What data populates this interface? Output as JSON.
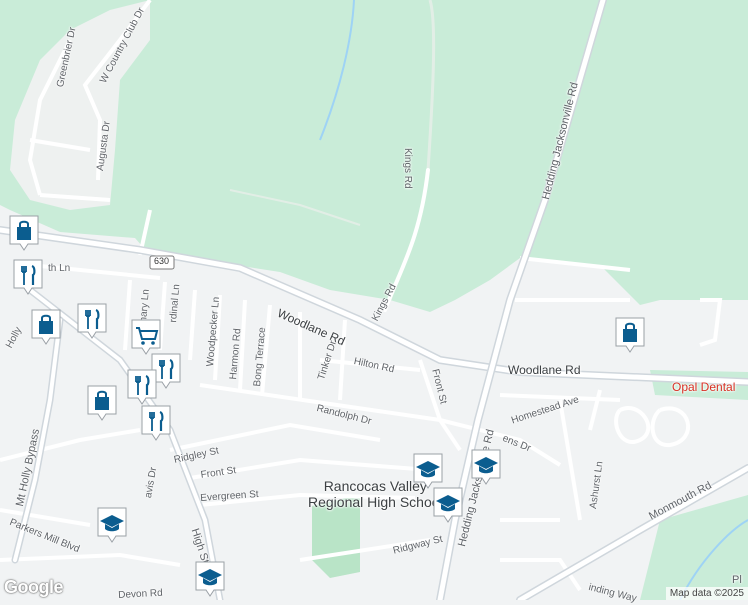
{
  "map": {
    "colors": {
      "forest": "#c9ecd8",
      "background": "#f1f3f4",
      "road_minor": "#ffffff",
      "road_major": "#cfd6dc",
      "water": "#9ed3f5",
      "school_ground": "#b9e4c7",
      "marker_fill": "#0b5d8f",
      "dental_text": "#d93025"
    },
    "roads": {
      "woodlane_1": "Woodlane Rd",
      "woodlane_2": "Woodlane Rd",
      "kings_1": "Kings Rd",
      "kings_2": "Kings Rd",
      "hedding": "Hedding Jacksonville Rd",
      "hedding_low": "Hedding Jacksonville Rd",
      "route_shield": "630",
      "greenbrier": "Greenbrier Dr",
      "w_country_club": "W Country Club Dr",
      "augusta": "Augusta Dr",
      "th_ln": "th Ln",
      "nary_ln": "nary Ln",
      "cardinal_ln": "rdinal Ln",
      "woodpecker": "Woodpecker Ln",
      "harmon": "Harmon Rd",
      "bong": "Bong Terrace",
      "tinker": "Tinker Dr",
      "hilton": "Hilton Rd",
      "front_st_v": "Front St",
      "homestead": "Homestead Ave",
      "randolph": "Randolph Dr",
      "ridgley": "Ridgley St",
      "front_st_h": "Front St",
      "evergreen": "Evergreen St",
      "mt_holly_bypass": "Mt Holly Bypass",
      "holly": "Holly",
      "parkers_mill": "Parkers Mill Blvd",
      "high_st": "High St",
      "avis": "avis Dr",
      "ridgway": "Ridgway St",
      "stevens": "ens Dr",
      "ashurst": "Ashurst Ln",
      "monmouth": "Monmouth Rd",
      "devon": "Devon Rd",
      "winding_way": "inding Way"
    },
    "poi": {
      "school_line1": "Rancocas Valley",
      "school_line2": "Regional High School",
      "dental": "Opal Dental",
      "partial_pl": "Pl"
    },
    "markers": [
      {
        "icon": "shopping-bag-icon"
      },
      {
        "icon": "shopping-bag-icon"
      },
      {
        "icon": "shopping-bag-icon"
      },
      {
        "icon": "restaurant-icon"
      },
      {
        "icon": "restaurant-icon"
      },
      {
        "icon": "shopping-cart-icon"
      },
      {
        "icon": "restaurant-icon"
      },
      {
        "icon": "restaurant-icon"
      },
      {
        "icon": "restaurant-icon"
      },
      {
        "icon": "school-icon"
      },
      {
        "icon": "school-icon"
      },
      {
        "icon": "school-icon"
      },
      {
        "icon": "school-icon"
      },
      {
        "icon": "school-icon"
      }
    ],
    "attribution": "Map data ©2025",
    "logo": "Google"
  }
}
